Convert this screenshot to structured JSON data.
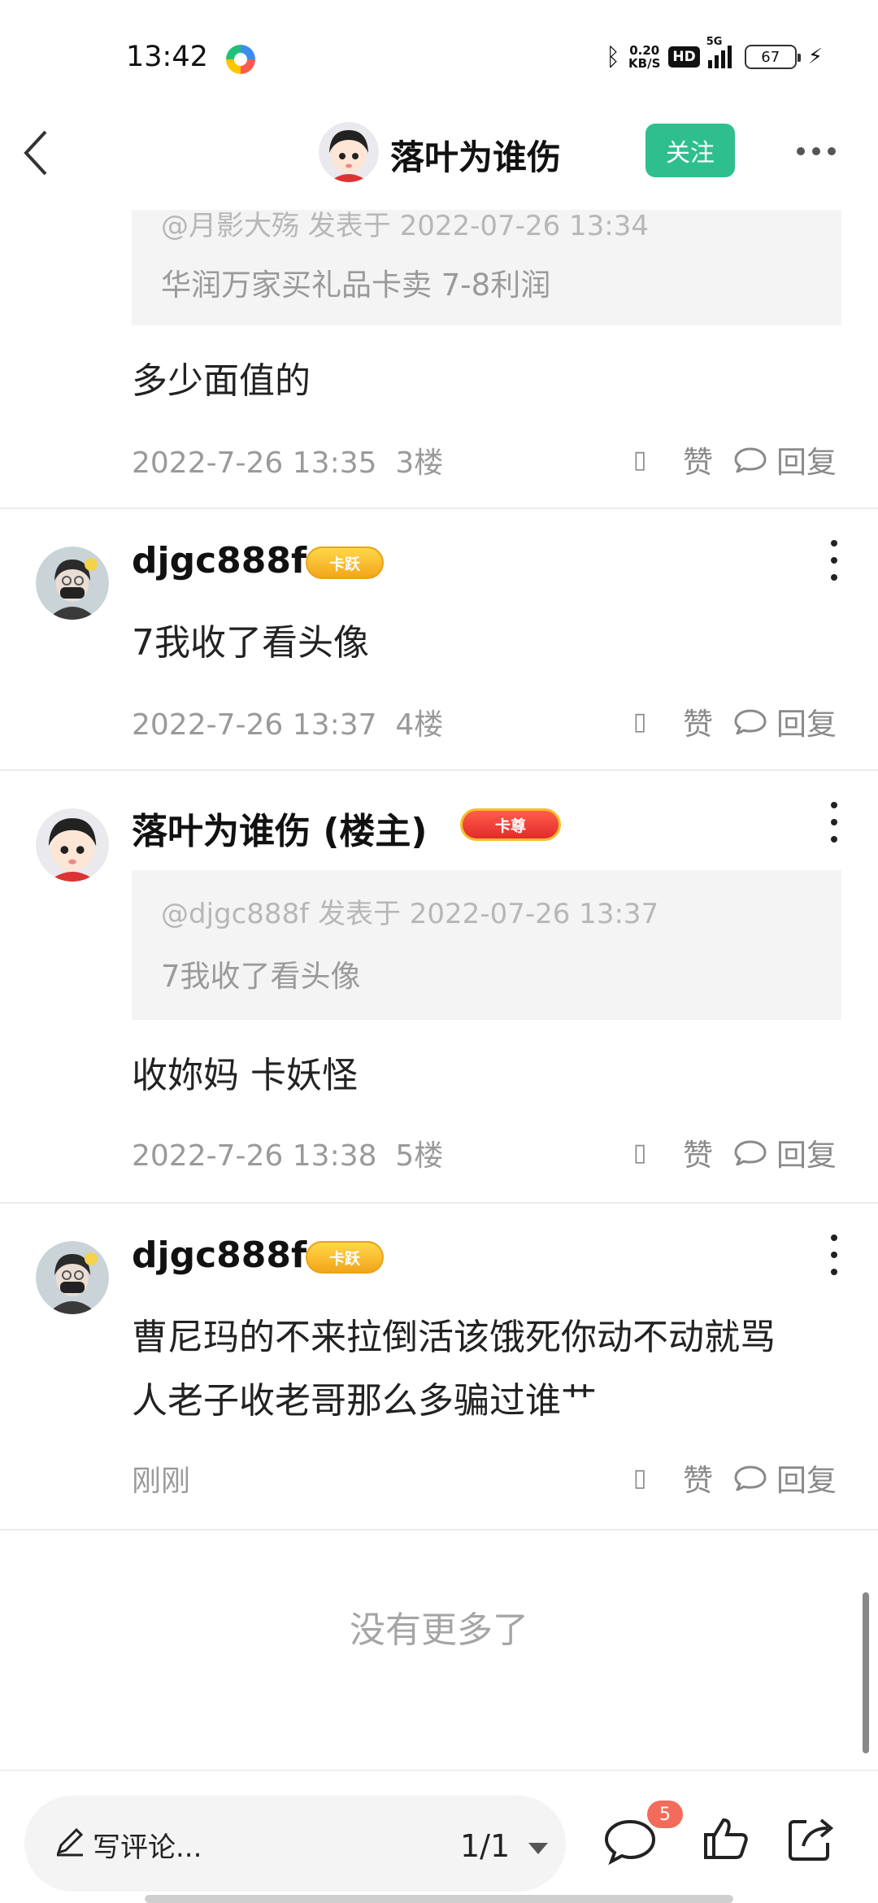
{
  "status_bar": {
    "time": "13:42",
    "speed_value": "0.20",
    "speed_unit": "KB/S",
    "hd": "HD",
    "network": "5G",
    "battery": "67"
  },
  "header": {
    "title": "落叶为谁伤",
    "follow_label": "关注"
  },
  "colors": {
    "accent_green": "#2fbf8f",
    "badge_red": "#f36b5a"
  },
  "posts": [
    {
      "quote_meta": "@月影大殇 发表于 2022-07-26 13:34",
      "quote_text": "华润万家买礼品卡卖 7-8利润",
      "text": "多少面值的",
      "time": "2022-7-26 13:35",
      "floor": "3楼",
      "like_label": "赞",
      "reply_label": "回复"
    },
    {
      "username": "djgc888f",
      "badge": "卡跃",
      "text": "7我收了看头像",
      "time": "2022-7-26 13:37",
      "floor": "4楼",
      "like_label": "赞",
      "reply_label": "回复"
    },
    {
      "username": "落叶为谁伤 (楼主)",
      "badge": "卡尊",
      "quote_meta": "@djgc888f 发表于 2022-07-26 13:37",
      "quote_text": "7我收了看头像",
      "text": "收妳妈 卡妖怪",
      "time": "2022-7-26 13:38",
      "floor": "5楼",
      "like_label": "赞",
      "reply_label": "回复"
    },
    {
      "username": "djgc888f",
      "badge": "卡跃",
      "text_line1": "曹尼玛的不来拉倒活该饿死你动不动就骂",
      "text_line2": "人老子收老哥那么多骗过谁艹",
      "time": "刚刚",
      "like_label": "赞",
      "reply_label": "回复"
    }
  ],
  "no_more": "没有更多了",
  "bottom_bar": {
    "placeholder": "写评论...",
    "page": "1/1",
    "comment_badge": "5"
  }
}
